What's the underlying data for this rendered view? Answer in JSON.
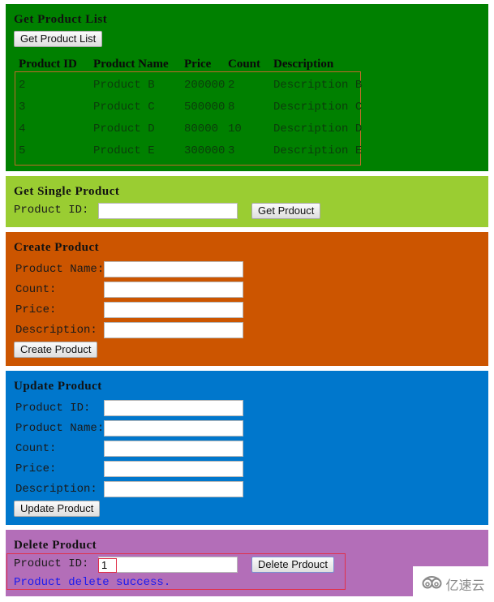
{
  "get_list": {
    "heading": "Get Product List",
    "button_label": "Get Product List",
    "columns": [
      "Product ID",
      "Product Name",
      "Price",
      "Count",
      "Description"
    ],
    "rows": [
      [
        "2",
        "Product B",
        "200000",
        "2",
        "Description B"
      ],
      [
        "3",
        "Product C",
        "500000",
        "8",
        "Description C"
      ],
      [
        "4",
        "Product D",
        "80000",
        "10",
        "Description D"
      ],
      [
        "5",
        "Product E",
        "300000",
        "3",
        "Description E"
      ]
    ],
    "bg_color": "#008000"
  },
  "get_single": {
    "heading": "Get Single Product",
    "id_label": "Product ID:",
    "id_value": "",
    "button_label": "Get Prdouct",
    "bg_color": "#9acd32"
  },
  "create": {
    "heading": "Create Product",
    "fields": [
      {
        "label": "Product Name:",
        "value": ""
      },
      {
        "label": "Count:",
        "value": ""
      },
      {
        "label": "Price:",
        "value": ""
      },
      {
        "label": "Description:",
        "value": ""
      }
    ],
    "button_label": "Create Product",
    "bg_color": "#cc5500"
  },
  "update": {
    "heading": "Update Product",
    "fields": [
      {
        "label": "Product ID:",
        "value": ""
      },
      {
        "label": "Product Name:",
        "value": ""
      },
      {
        "label": "Count:",
        "value": ""
      },
      {
        "label": "Price:",
        "value": ""
      },
      {
        "label": "Description:",
        "value": ""
      }
    ],
    "button_label": "Update Product",
    "bg_color": "#0077cc"
  },
  "delete": {
    "heading": "Delete Product",
    "id_label": "Product ID:",
    "id_value": "1",
    "button_label": "Delete Prdouct",
    "status_message": "Product delete success.",
    "status_color": "#1a1aee",
    "bg_color": "#b36eb8"
  },
  "watermark": {
    "icon": "cloud-logo-icon",
    "text": "亿速云"
  }
}
